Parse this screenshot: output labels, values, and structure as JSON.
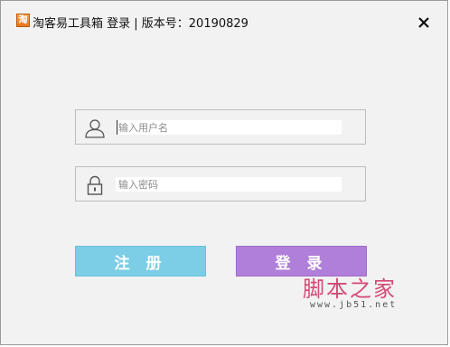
{
  "window": {
    "title": "淘客易工具箱 登录 | 版本号：20190829",
    "app_icon_glyph": "淘",
    "close_label": "×"
  },
  "form": {
    "username": {
      "placeholder": "输入用户名",
      "value": "",
      "icon": "user-icon"
    },
    "password": {
      "placeholder": "输入密码",
      "value": "",
      "icon": "lock-icon"
    }
  },
  "buttons": {
    "register": "注 册",
    "login": "登 录"
  },
  "colors": {
    "register_bg": "#7ccde6",
    "login_bg": "#b07fd9",
    "window_bg": "#f2f2f2"
  },
  "watermark": {
    "text": "脚本之家",
    "url": "www.jb51.net"
  }
}
